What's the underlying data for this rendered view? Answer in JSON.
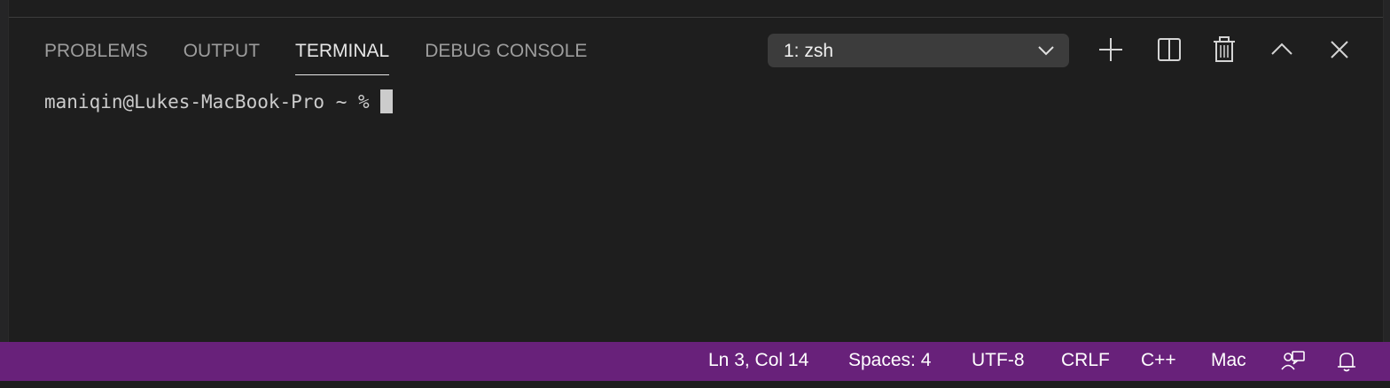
{
  "panel": {
    "tabs": [
      {
        "label": "PROBLEMS"
      },
      {
        "label": "OUTPUT"
      },
      {
        "label": "TERMINAL"
      },
      {
        "label": "DEBUG CONSOLE"
      }
    ],
    "active_tab": "TERMINAL",
    "terminal_select": {
      "value": "1: zsh"
    },
    "actions": [
      "plus-icon",
      "split-icon",
      "trash-icon",
      "chevron-up-icon",
      "close-icon"
    ]
  },
  "terminal": {
    "prompt": "maniqin@Lukes-MacBook-Pro ~ %"
  },
  "statusbar": {
    "position": "Ln 3, Col 14",
    "spaces": "Spaces: 4",
    "encoding": "UTF-8",
    "eol": "CRLF",
    "language": "C++",
    "platform": "Mac",
    "icons": [
      "feedback-icon",
      "bell-icon"
    ],
    "color": "#68217a"
  },
  "colors": {
    "background": "#1e1e1e",
    "select_bg": "#3c3c3c",
    "active_tab": "#e7e7e7",
    "inactive_tab": "#9d9d9d"
  }
}
